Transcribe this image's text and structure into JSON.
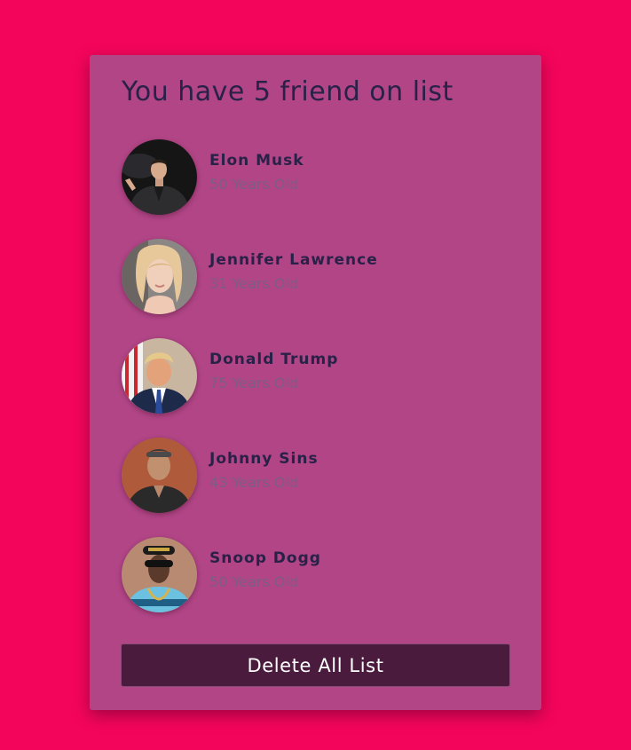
{
  "card": {
    "title": "You have 5 friend on list",
    "friends": [
      {
        "name": "Elon Musk",
        "age": "50 Years Old",
        "avatar_icon": "person-photo-icon"
      },
      {
        "name": "Jennifer Lawrence",
        "age": "31 Years Old",
        "avatar_icon": "person-photo-icon"
      },
      {
        "name": "Donald Trump",
        "age": "75 Years Old",
        "avatar_icon": "person-photo-icon"
      },
      {
        "name": "Johnny Sins",
        "age": "43 Years Old",
        "avatar_icon": "person-photo-icon"
      },
      {
        "name": "Snoop Dogg",
        "age": "50 Years Old",
        "avatar_icon": "person-photo-icon"
      }
    ],
    "delete_label": "Delete All List"
  },
  "colors": {
    "page_background": "#f4055c",
    "card_background": "#b14586",
    "heading_text": "#2a2148",
    "age_text": "#7d5d83",
    "button_background": "#4b1b3d",
    "button_text": "#ffffff"
  }
}
